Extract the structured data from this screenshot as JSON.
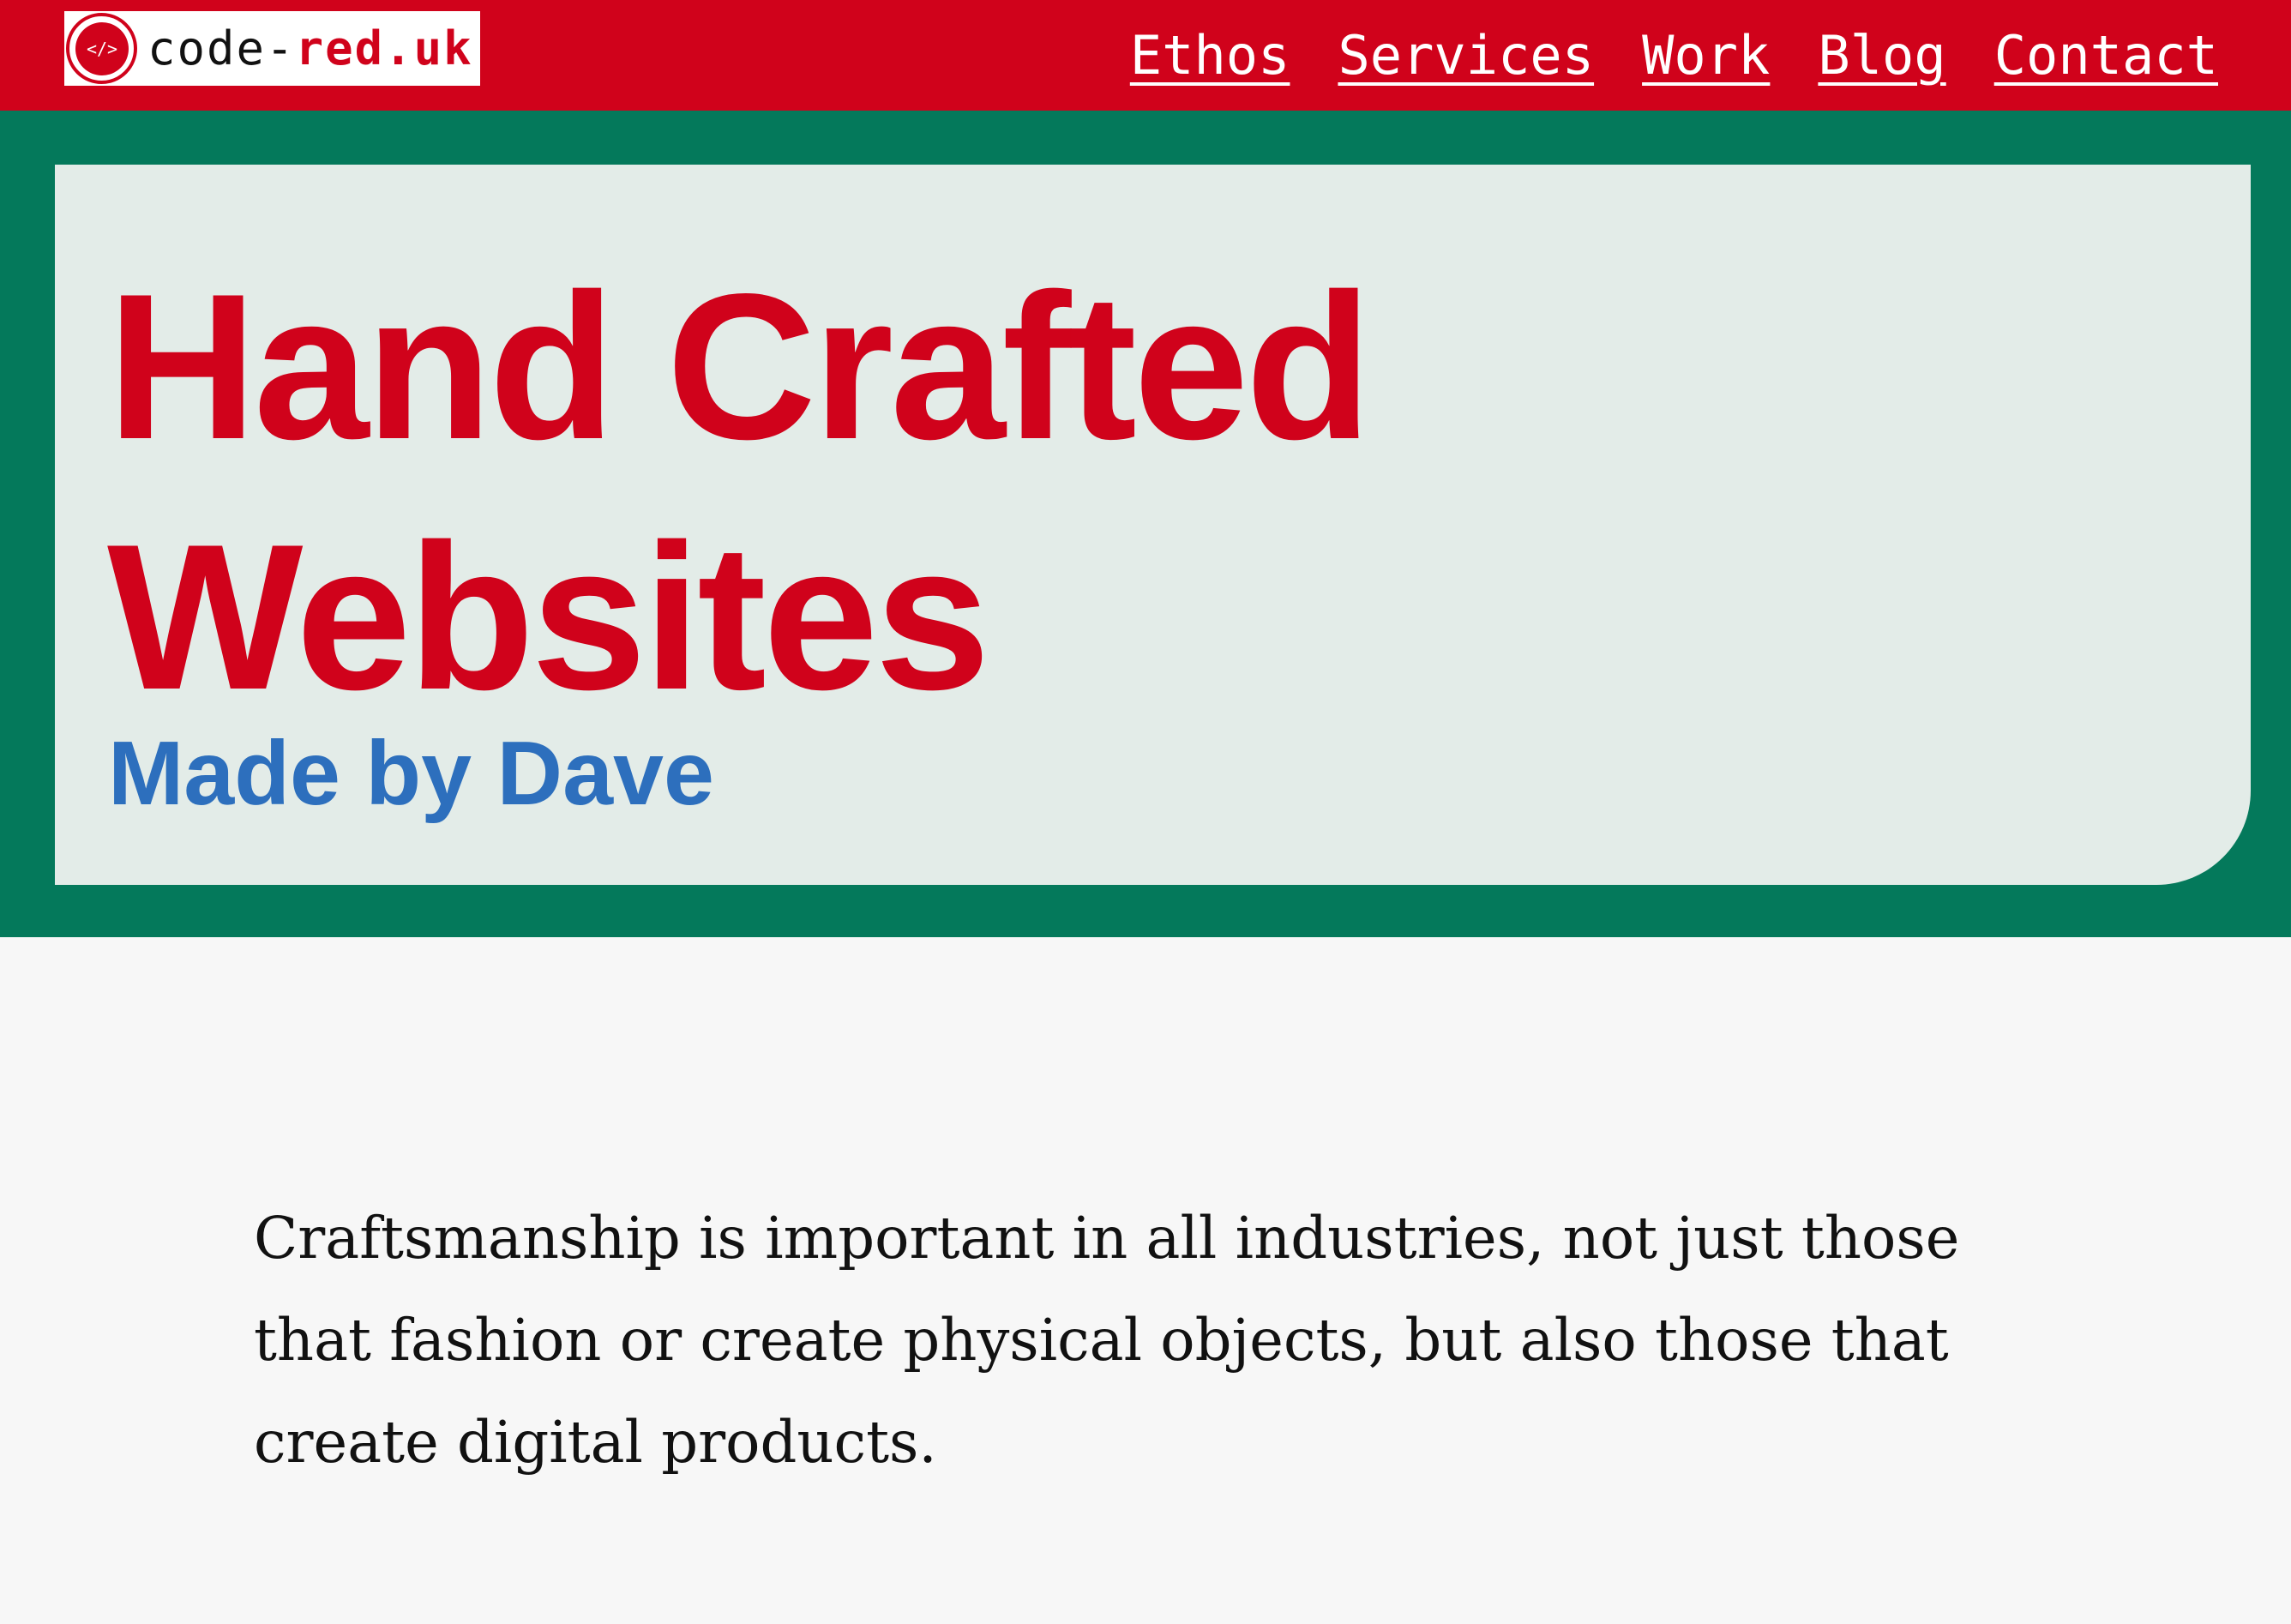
{
  "header": {
    "logo": {
      "icon": "code-brackets-icon",
      "icon_glyph": "</>",
      "name_base": "code-",
      "name_accent": "red.uk"
    },
    "nav": [
      {
        "label": "Ethos"
      },
      {
        "label": "Services"
      },
      {
        "label": "Work"
      },
      {
        "label": "Blog"
      },
      {
        "label": "Contact"
      }
    ]
  },
  "hero": {
    "title_line1": "Hand Crafted",
    "title_line2": "Websites",
    "subtitle": "Made by Dave"
  },
  "main": {
    "intro": "Craftsmanship is important in all industries, not just those that fashion or create physical objects, but also those that create digital products."
  },
  "colors": {
    "brand_red": "#d0021b",
    "hero_green": "#04795b",
    "hero_card": "#e3ece8",
    "subtitle_blue": "#2d6fbd",
    "page_bg": "#f7f7f7"
  }
}
